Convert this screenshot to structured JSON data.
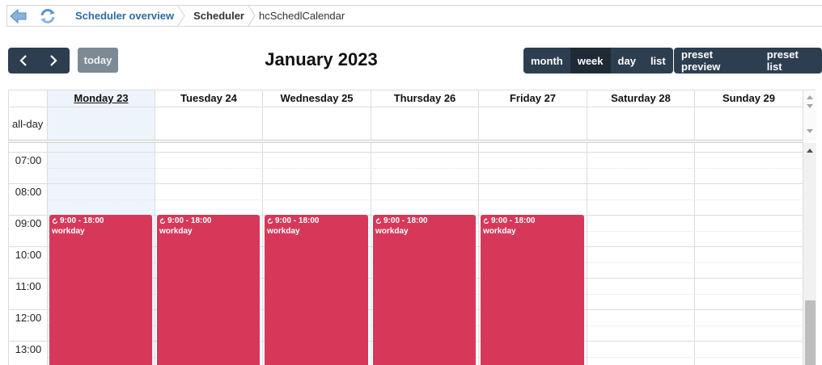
{
  "breadcrumb": {
    "items": [
      "Scheduler overview",
      "Scheduler",
      "hcSchedlCalendar"
    ]
  },
  "toolbar": {
    "prev_icon": "chevron-left-icon",
    "next_icon": "chevron-right-icon",
    "today_label": "today",
    "title": "January 2023",
    "views": [
      "month",
      "week",
      "day",
      "list"
    ],
    "active_view": "week",
    "preset": [
      "preset preview",
      "preset list"
    ]
  },
  "calendar": {
    "days": [
      "Monday 23",
      "Tuesday 24",
      "Wednesday 25",
      "Thursday 26",
      "Friday 27",
      "Saturday 28",
      "Sunday 29"
    ],
    "today_index": 0,
    "allday_label": "all-day",
    "hours": [
      "07:00",
      "08:00",
      "09:00",
      "10:00",
      "11:00",
      "12:00",
      "13:00"
    ],
    "events": [
      {
        "time": "9:00 - 18:00",
        "title": "workday",
        "recurring_icon": "recurring-icon"
      },
      {
        "time": "9:00 - 18:00",
        "title": "workday",
        "recurring_icon": "recurring-icon"
      },
      {
        "time": "9:00 - 18:00",
        "title": "workday",
        "recurring_icon": "recurring-icon"
      },
      {
        "time": "9:00 - 18:00",
        "title": "workday",
        "recurring_icon": "recurring-icon"
      },
      {
        "time": "9:00 - 18:00",
        "title": "workday",
        "recurring_icon": "recurring-icon"
      }
    ]
  },
  "colors": {
    "toolbar_bg": "#2c3e50",
    "event_bg": "#d7385a",
    "today_bg": "#eef4fc",
    "link": "#2f6aa1"
  }
}
